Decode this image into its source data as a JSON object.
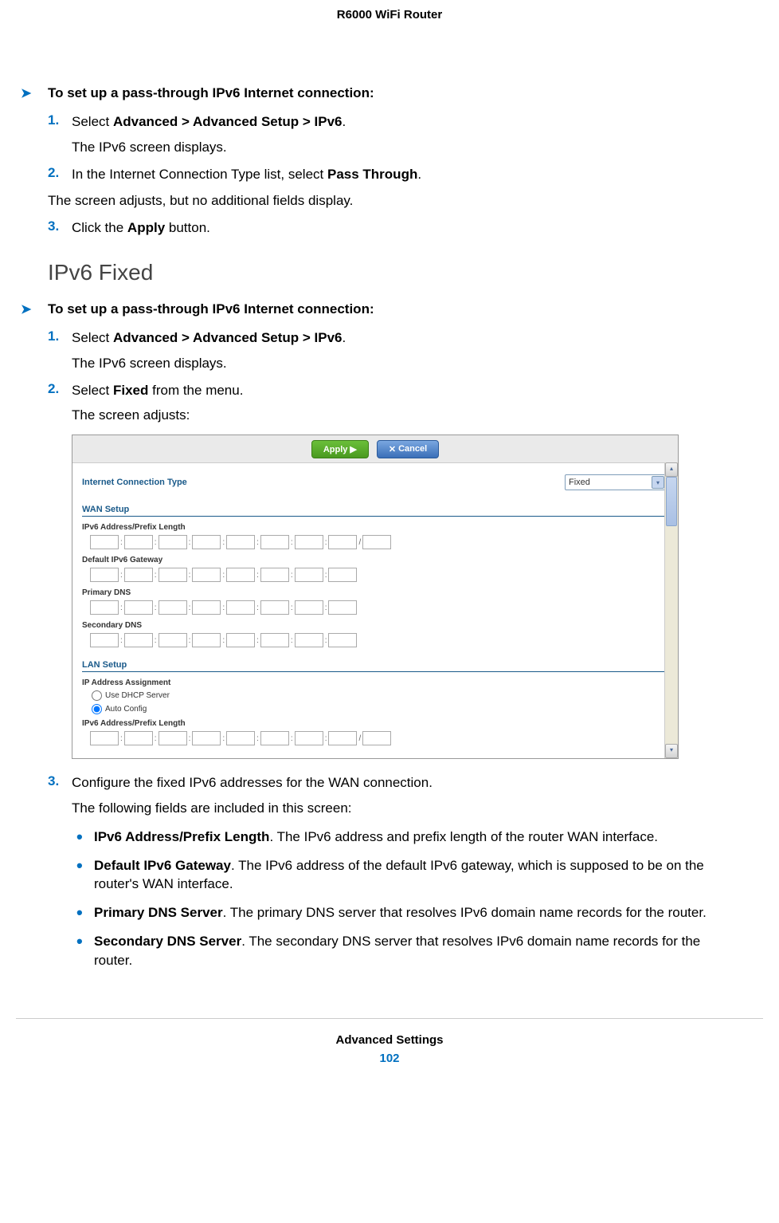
{
  "header": "R6000 WiFi Router",
  "proc1": {
    "heading": "To set up a pass-through IPv6 Internet connection:",
    "step1_num": "1.",
    "step1_a": "Select ",
    "step1_b": "Advanced > Advanced Setup > IPv6",
    "step1_c": ".",
    "step1_sub": "The IPv6 screen displays.",
    "step2_num": "2.",
    "step2_a": "In the Internet Connection Type list, select ",
    "step2_b": "Pass Through",
    "step2_c": ".",
    "step2_note": "The screen adjusts, but no additional fields display.",
    "step3_num": "3.",
    "step3_a": "Click the ",
    "step3_b": "Apply",
    "step3_c": " button."
  },
  "h2": "IPv6 Fixed",
  "proc2": {
    "heading": "To set up a pass-through IPv6 Internet connection:",
    "step1_num": "1.",
    "step1_a": "Select ",
    "step1_b": "Advanced > Advanced Setup > IPv6",
    "step1_c": ".",
    "step1_sub": "The IPv6 screen displays.",
    "step2_num": "2.",
    "step2_a": "Select ",
    "step2_b": "Fixed",
    "step2_c": " from the menu.",
    "step2_sub": "The screen adjusts:",
    "step3_num": "3.",
    "step3_a": "Configure the fixed IPv6 addresses for the WAN connection.",
    "step3_sub": "The following fields are included in this screen:"
  },
  "screenshot": {
    "apply": "Apply ▶",
    "cancel": "Cancel",
    "cancel_x": "✕",
    "conn_type_label": "Internet Connection Type",
    "conn_type_value": "Fixed",
    "wan_setup": "WAN Setup",
    "ipv6_addr_len": "IPv6 Address/Prefix Length",
    "default_gw": "Default IPv6 Gateway",
    "primary_dns": "Primary DNS",
    "secondary_dns": "Secondary DNS",
    "lan_setup": "LAN Setup",
    "ip_assign": "IP Address Assignment",
    "radio_dhcp": "Use DHCP Server",
    "radio_auto": "Auto Config",
    "ipv6_addr_len2": "IPv6 Address/Prefix Length"
  },
  "bullets": {
    "b1_t": "IPv6 Address/Prefix Length",
    "b1_r": ". The IPv6 address and prefix length of the router WAN interface.",
    "b2_t": "Default IPv6 Gateway",
    "b2_r": ". The IPv6 address of the default IPv6 gateway, which is supposed to be on the router's WAN interface.",
    "b3_t": "Primary DNS Server",
    "b3_r": ". The primary DNS server that resolves IPv6 domain name records for the router.",
    "b4_t": "Secondary DNS Server",
    "b4_r": ". The secondary DNS server that resolves IPv6 domain name records for the router."
  },
  "footer": {
    "name": "Advanced Settings",
    "page": "102"
  }
}
